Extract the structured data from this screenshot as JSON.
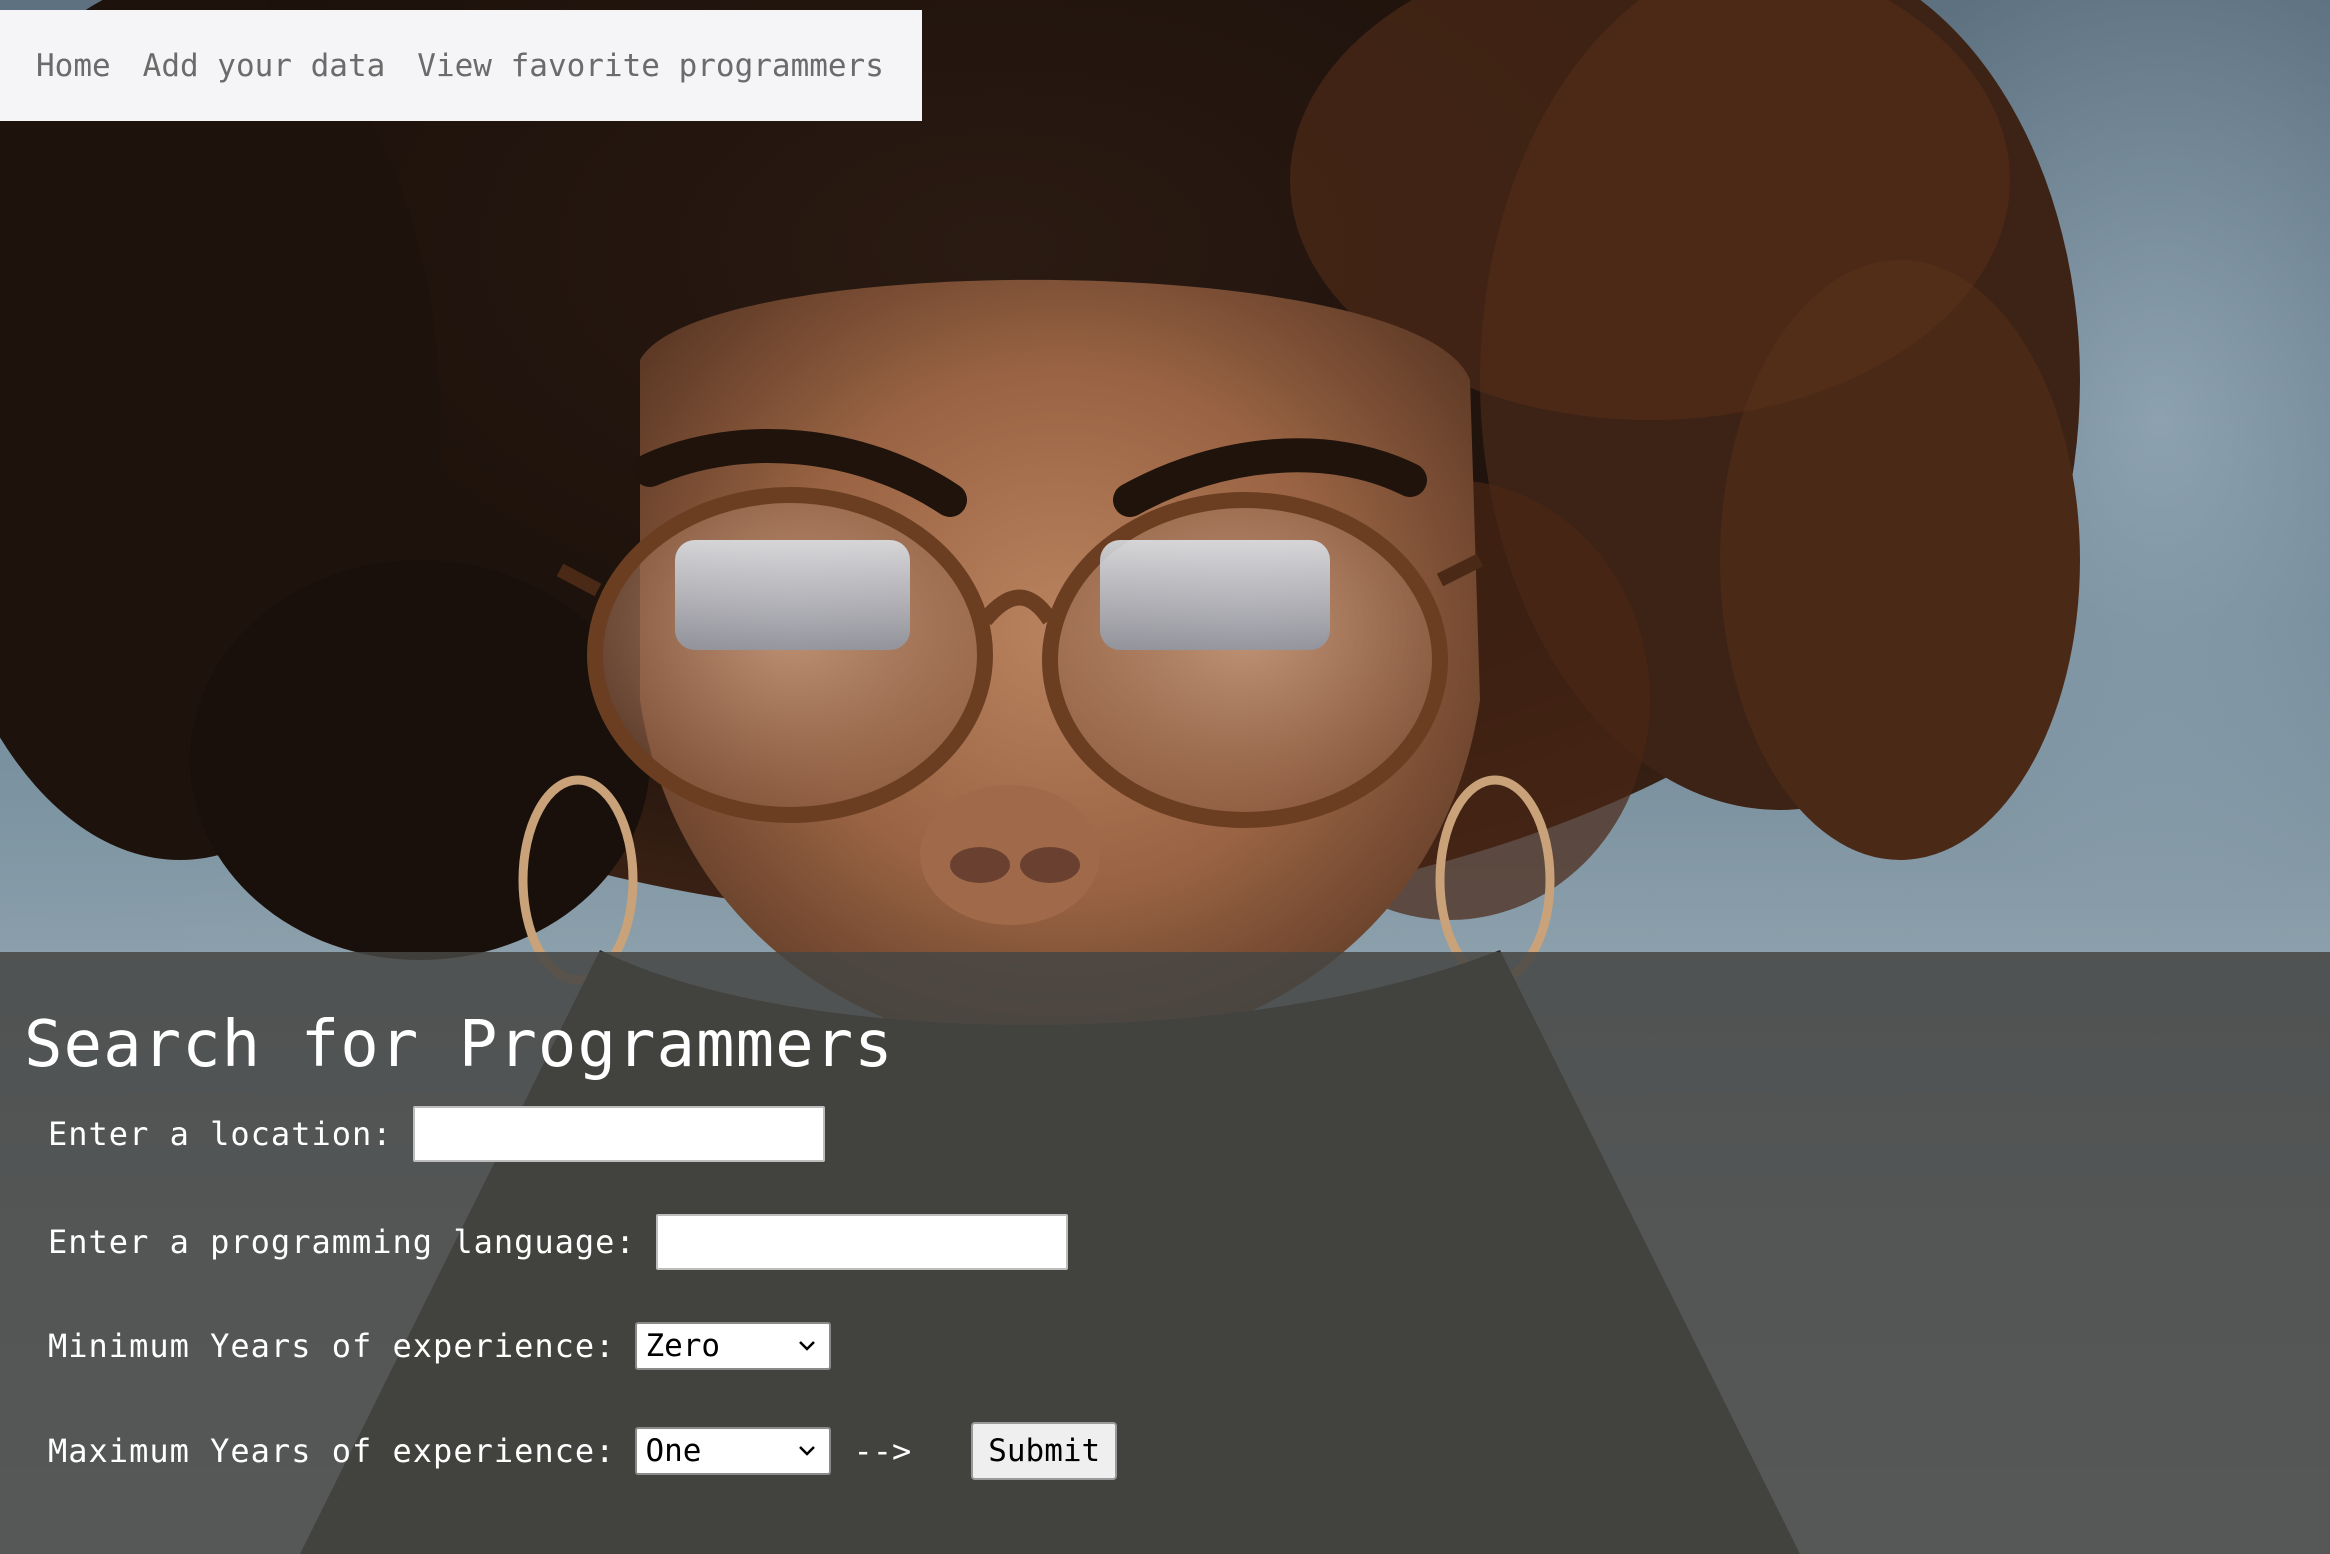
{
  "nav": {
    "items": [
      {
        "label": "Home"
      },
      {
        "label": "Add your data"
      },
      {
        "label": "View favorite programmers"
      }
    ]
  },
  "hero": {
    "image": "woman-with-glasses-photo"
  },
  "search": {
    "title": "Search for Programmers",
    "location_label": "Enter a location:",
    "location_value": "",
    "language_label": "Enter a programming language:",
    "language_value": "",
    "min_label": "Minimum Years of experience:",
    "min_value": "Zero",
    "max_label": "Maximum Years of experience:",
    "max_value": "One",
    "arrow_text": "-->",
    "submit_label": "Submit"
  },
  "colors": {
    "nav_bg": "#f5f5f7",
    "nav_text": "#6b6b6b",
    "panel_bg": "#464644",
    "label_text": "#ffffff"
  },
  "icons": {
    "select_chevron": "chevron-down-icon"
  }
}
